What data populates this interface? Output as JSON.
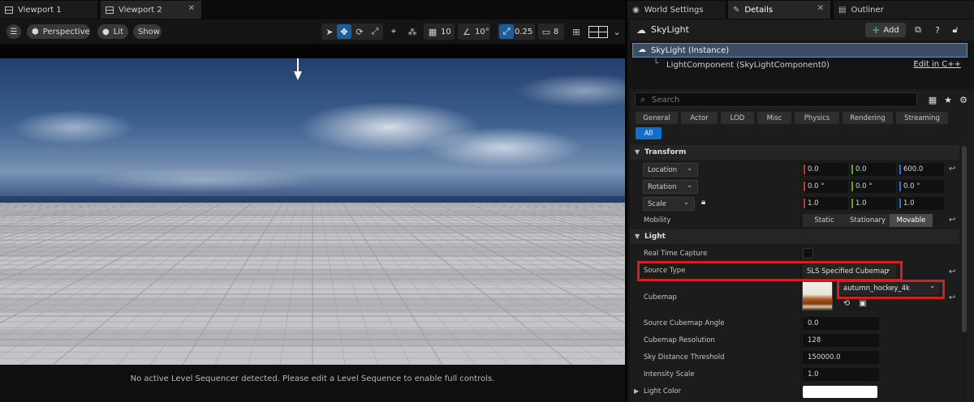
{
  "viewport": {
    "tabs": [
      {
        "label": "Viewport 1"
      },
      {
        "label": "Viewport 2",
        "close": "✕"
      }
    ],
    "toolbar": {
      "menu_icon": "hamburger-icon",
      "perspective_label": "Perspective",
      "lit_label": "Lit",
      "show_label": "Show",
      "grid_snap_value": "10",
      "rotation_snap_value": "10°",
      "scale_snap_value": "0.25",
      "camera_speed_value": "8"
    },
    "status_message": "No active Level Sequencer detected. Please edit a Level Sequence to enable full controls."
  },
  "right_tabs": [
    {
      "label": "World Settings",
      "icon": "world-icon"
    },
    {
      "label": "Details",
      "icon": "details-icon",
      "close": "✕"
    },
    {
      "label": "Outliner",
      "icon": "outliner-icon"
    }
  ],
  "details": {
    "actor_name": "SkyLight",
    "add_label": "Add",
    "components": {
      "root": "SkyLight (Instance)",
      "child": "LightComponent (SkyLightComponent0)",
      "edit_link": "Edit in C++"
    },
    "search_placeholder": "Search",
    "categories": [
      "General",
      "Actor",
      "LOD",
      "Misc",
      "Physics",
      "Rendering",
      "Streaming",
      "All"
    ],
    "active_category": "All",
    "transform": {
      "title": "Transform",
      "location": {
        "label": "Location",
        "x": "0.0",
        "y": "0.0",
        "z": "600.0"
      },
      "rotation": {
        "label": "Rotation",
        "x": "0.0 °",
        "y": "0.0 °",
        "z": "0.0 °"
      },
      "scale": {
        "label": "Scale",
        "x": "1.0",
        "y": "1.0",
        "z": "1.0"
      },
      "mobility": {
        "label": "Mobility",
        "options": [
          "Static",
          "Stationary",
          "Movable"
        ],
        "selected": "Movable"
      }
    },
    "light": {
      "title": "Light",
      "real_time_capture": {
        "label": "Real Time Capture",
        "checked": false
      },
      "source_type": {
        "label": "Source Type",
        "value": "SLS Specified Cubemap"
      },
      "cubemap": {
        "label": "Cubemap",
        "value": "autumn_hockey_4k"
      },
      "source_cubemap_angle": {
        "label": "Source Cubemap Angle",
        "value": "0.0"
      },
      "cubemap_resolution": {
        "label": "Cubemap Resolution",
        "value": "128"
      },
      "sky_distance_threshold": {
        "label": "Sky Distance Threshold",
        "value": "150000.0"
      },
      "intensity_scale": {
        "label": "Intensity Scale",
        "value": "1.0"
      },
      "light_color": {
        "label": "Light Color",
        "value": "#ffffff"
      }
    }
  },
  "colors": {
    "accent": "#0e6fd1",
    "highlight": "#d0201f",
    "axis_x": "#c23a2b",
    "axis_y": "#5fa32f",
    "axis_z": "#3a6fd0"
  }
}
